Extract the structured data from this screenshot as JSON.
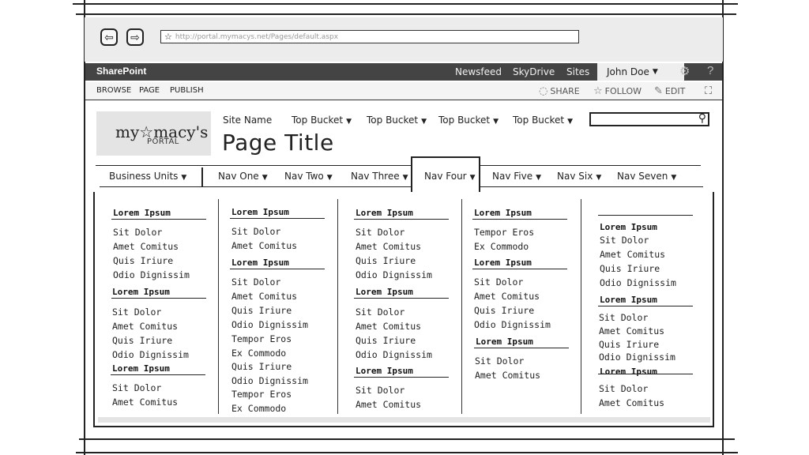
{
  "browser": {
    "url": "http://portal.mymacys.net/Pages/default.aspx",
    "back_icon": "back-arrow-icon",
    "forward_icon": "forward-arrow-icon",
    "favorite_icon": "star-icon"
  },
  "suite_bar": {
    "brand": "SharePoint",
    "links": [
      "Newsfeed",
      "SkyDrive",
      "Sites"
    ],
    "user": "John Doe",
    "settings_icon": "gear-icon",
    "help_icon": "question-icon"
  },
  "ribbon": {
    "tabs": [
      "BROWSE",
      "PAGE",
      "PUBLISH"
    ],
    "actions": [
      "SHARE",
      "FOLLOW",
      "EDIT"
    ],
    "focus_icon": "fullscreen-icon"
  },
  "logo": {
    "main": "my☆macy's",
    "sub": "PORTAL"
  },
  "site_nav": {
    "site_name": "Site Name",
    "buckets": [
      "Top Bucket",
      "Top Bucket",
      "Top Bucket",
      "Top Bucket"
    ]
  },
  "page_title": "Page Title",
  "main_nav": {
    "business_units": "Business Units",
    "items": [
      "Nav One",
      "Nav Two",
      "Nav Three",
      "Nav Four",
      "Nav Five",
      "Nav Six",
      "Nav Seven"
    ],
    "active": "Nav Four"
  },
  "mega_menu": {
    "columns": [
      {
        "groups": [
          {
            "heading": "Lorem Ipsum",
            "items": [
              "Sit Dolor",
              "Amet Comitus",
              "Quis Iriure",
              "Odio Dignissim"
            ]
          },
          {
            "heading": "Lorem Ipsum",
            "items": [
              "Sit Dolor",
              "Amet Comitus",
              "Quis Iriure",
              "Odio Dignissim"
            ]
          },
          {
            "heading": "Lorem Ipsum",
            "items": [
              "Sit Dolor",
              "Amet Comitus"
            ]
          }
        ]
      },
      {
        "groups": [
          {
            "heading": "Lorem Ipsum",
            "items": [
              "Sit Dolor",
              "Amet Comitus"
            ]
          },
          {
            "heading": "Lorem Ipsum",
            "items": [
              "Sit Dolor",
              "Amet Comitus",
              "Quis Iriure",
              "Odio Dignissim",
              "Tempor Eros",
              "Ex Commodo",
              "Quis Iriure",
              "Odio Dignissim",
              "Tempor Eros",
              "Ex Commodo"
            ]
          }
        ]
      },
      {
        "groups": [
          {
            "heading": "Lorem Ipsum",
            "items": [
              "Sit Dolor",
              "Amet Comitus",
              "Quis Iriure",
              "Odio Dignissim"
            ]
          },
          {
            "heading": "Lorem Ipsum",
            "items": [
              "Sit Dolor",
              "Amet Comitus",
              "Quis Iriure",
              "Odio Dignissim"
            ]
          },
          {
            "heading": "Lorem Ipsum",
            "items": [
              "Sit Dolor",
              "Amet Comitus"
            ]
          }
        ]
      },
      {
        "groups": [
          {
            "heading": "Lorem Ipsum",
            "items": [
              "Tempor Eros",
              "Ex Commodo"
            ]
          },
          {
            "heading": "Lorem Ipsum",
            "items": [
              "Sit Dolor",
              "Amet Comitus",
              "Quis Iriure",
              "Odio Dignissim"
            ]
          },
          {
            "heading": "Lorem Ipsum",
            "items": [
              "Sit Dolor",
              "Amet Comitus"
            ]
          }
        ]
      },
      {
        "groups": [
          {
            "heading": "Lorem Ipsum",
            "items": [
              "Sit Dolor",
              "Amet Comitus",
              "Quis Iriure",
              "Odio Dignissim"
            ]
          },
          {
            "heading": "Lorem Ipsum",
            "items": [
              "Sit Dolor",
              "Amet Comitus",
              "Quis Iriure",
              "Odio Dignissim"
            ]
          },
          {
            "heading": "Lorem Ipsum",
            "items": [
              "Sit Dolor",
              "Amet Comitus"
            ]
          }
        ]
      }
    ]
  }
}
